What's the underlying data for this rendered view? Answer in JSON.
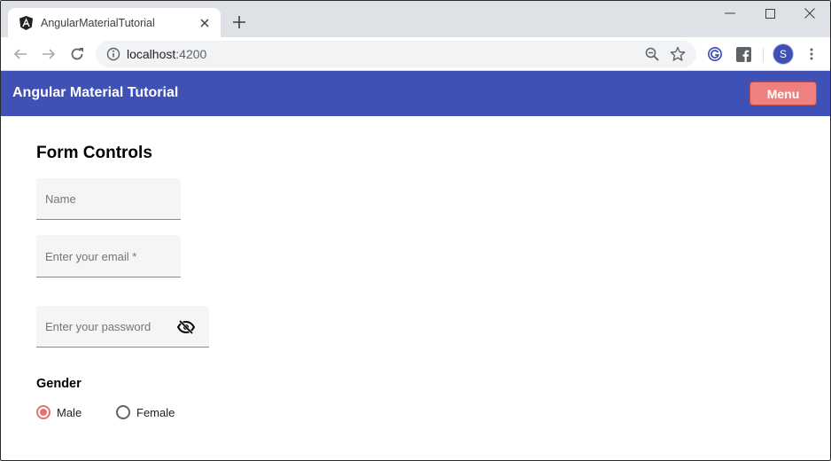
{
  "browser": {
    "tab": {
      "title": "AngularMaterialTutorial",
      "favicon": "angular-icon"
    },
    "new_tab_icon": "plus-icon",
    "window_controls": [
      "minimize-icon",
      "maximize-icon",
      "close-icon"
    ],
    "address_bar": {
      "host": "localhost",
      "port": ":4200",
      "info_icon": "info-icon",
      "zoom_icon": "zoom-out-icon",
      "bookmark_icon": "star-icon"
    },
    "extensions": [
      "google-icon",
      "facebook-icon"
    ],
    "profile_initial": "S",
    "menu_icon": "more-vert-icon"
  },
  "app": {
    "title": "Angular Material Tutorial",
    "menu_label": "Menu",
    "colors": {
      "primary": "#3f51b5",
      "accent": "#f08080",
      "radio_checked": "#e57373"
    }
  },
  "form": {
    "heading": "Form Controls",
    "name": {
      "label": "Name",
      "value": ""
    },
    "email": {
      "label": "Enter your email *",
      "value": ""
    },
    "password": {
      "label": "Enter your password",
      "value": "",
      "toggle_icon": "visibility-off-icon"
    },
    "gender": {
      "label": "Gender",
      "options": [
        {
          "label": "Male",
          "checked": true
        },
        {
          "label": "Female",
          "checked": false
        }
      ]
    }
  }
}
